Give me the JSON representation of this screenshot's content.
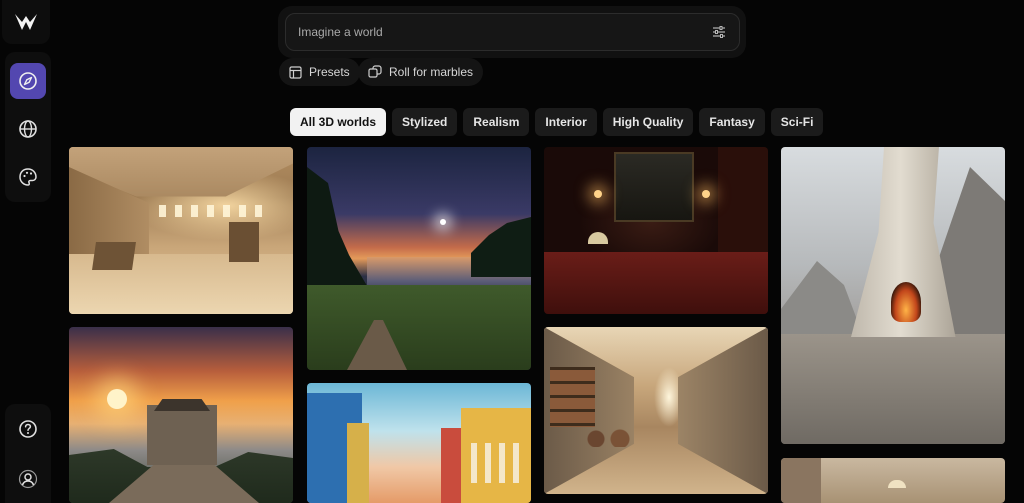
{
  "app": {
    "logo_icon": "marble-logo-icon"
  },
  "sidebar": {
    "nav": [
      {
        "icon": "compass-icon",
        "active": true
      },
      {
        "icon": "globe-icon",
        "active": false
      },
      {
        "icon": "palette-icon",
        "active": false
      }
    ],
    "bottom": [
      {
        "icon": "help-icon"
      },
      {
        "icon": "user-icon"
      }
    ],
    "accent_color": "#5347b0"
  },
  "search": {
    "placeholder": "Imagine a world",
    "value": "",
    "filter_icon": "sliders-icon"
  },
  "actions": {
    "presets_label": "Presets",
    "roll_label": "Roll for marbles"
  },
  "tabs": [
    {
      "label": "All 3D worlds",
      "active": true
    },
    {
      "label": "Stylized",
      "active": false
    },
    {
      "label": "Realism",
      "active": false
    },
    {
      "label": "Interior",
      "active": false
    },
    {
      "label": "High Quality",
      "active": false
    },
    {
      "label": "Fantasy",
      "active": false
    },
    {
      "label": "Sci-Fi",
      "active": false
    }
  ]
}
